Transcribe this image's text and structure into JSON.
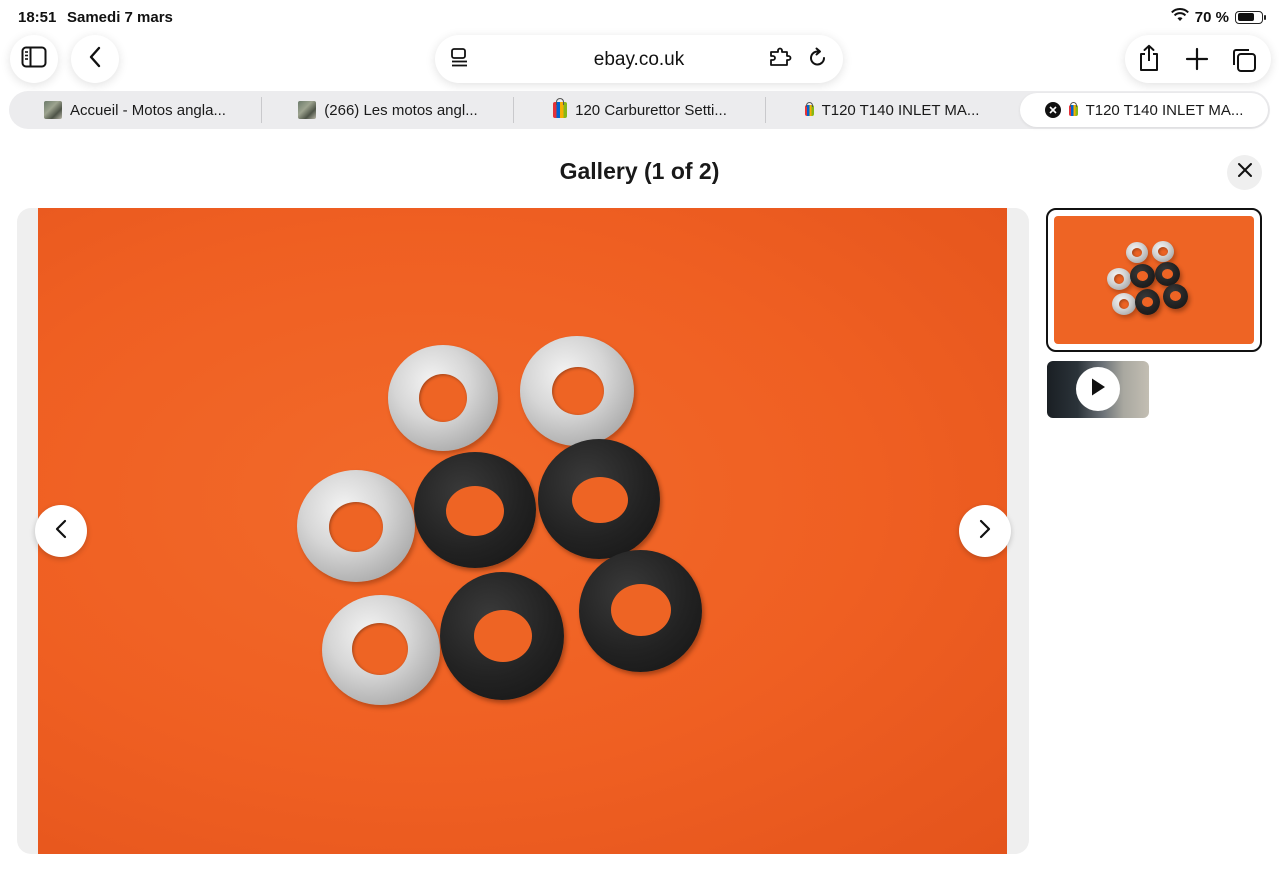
{
  "status_bar": {
    "time": "18:51",
    "date": "Samedi 7 mars",
    "battery_text": "70 %",
    "battery_level": 0.7
  },
  "toolbar": {
    "url": "ebay.co.uk",
    "icons": [
      "sidebar-icon",
      "back-icon",
      "reader-icon",
      "extension-icon",
      "reload-icon",
      "share-icon",
      "new-tab-icon",
      "tabs-overview-icon"
    ]
  },
  "tabs": [
    {
      "title": "Accueil - Motos angla...",
      "favicon": "photo",
      "active": false
    },
    {
      "title": "(266) Les motos angl...",
      "favicon": "photo",
      "active": false
    },
    {
      "title": "120 Carburettor Setti...",
      "favicon": "ebay-bag",
      "active": false
    },
    {
      "title": "T120 T140 INLET MA...",
      "favicon": "ebay-bag",
      "active": false
    },
    {
      "title": "T120 T140 INLET MA...",
      "favicon": "ebay-bag",
      "active": true
    }
  ],
  "gallery": {
    "title": "Gallery (1 of 2)",
    "thumbnails": [
      {
        "kind": "image",
        "selected": true
      },
      {
        "kind": "video",
        "selected": false
      }
    ]
  },
  "colors": {
    "accent_orange": "#ef5f22",
    "overlay_grey": "#efefef",
    "text": "#191919"
  }
}
